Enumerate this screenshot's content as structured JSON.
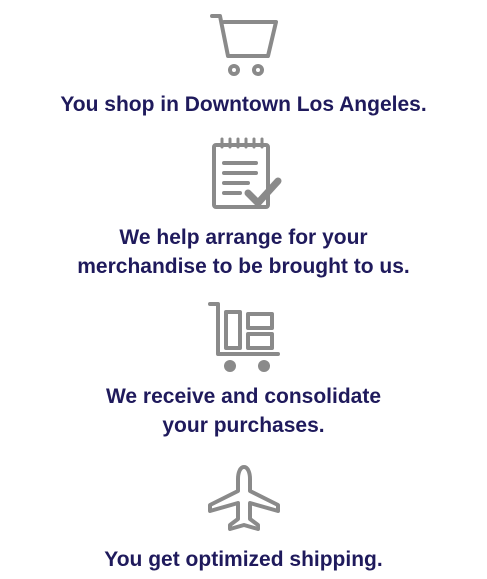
{
  "colors": {
    "text": "#1f1a5c",
    "icon": "#8a8a8a",
    "background": "#ffffff"
  },
  "steps": [
    {
      "icon": "shopping-cart-icon",
      "caption": "You shop in Downtown Los Angeles."
    },
    {
      "icon": "notepad-checkmark-icon",
      "caption": "We help arrange for your\nmerchandise to be brought to us."
    },
    {
      "icon": "hand-truck-packages-icon",
      "caption": "We receive and consolidate\nyour purchases."
    },
    {
      "icon": "airplane-icon",
      "caption": "You get optimized shipping."
    }
  ]
}
